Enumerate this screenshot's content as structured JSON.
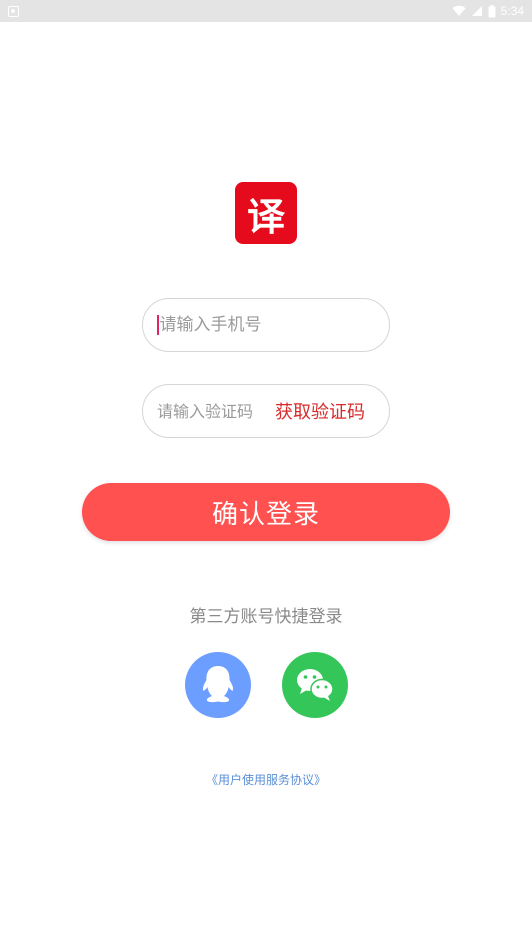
{
  "status_bar": {
    "time": "5:34",
    "icons": [
      "notification-icon",
      "wifi-icon",
      "signal-icon",
      "battery-icon"
    ]
  },
  "logo": {
    "char": "译",
    "color": "#e60b1c"
  },
  "phone_input": {
    "value": "",
    "placeholder": "请输入手机号"
  },
  "code_input": {
    "value": "",
    "placeholder": "请输入验证码"
  },
  "get_code_label": "获取验证码",
  "confirm_label": "确认登录",
  "third_party_label": "第三方账号快捷登录",
  "social": [
    {
      "name": "qq",
      "icon": "qq-icon",
      "color": "#6b9eff"
    },
    {
      "name": "wechat",
      "icon": "wechat-icon",
      "color": "#35c65a"
    }
  ],
  "agreement_label": "《用户使用服务协议》",
  "colors": {
    "accent": "#fe5150",
    "link": "#5b8fd6",
    "get_code": "#d72b2b"
  }
}
